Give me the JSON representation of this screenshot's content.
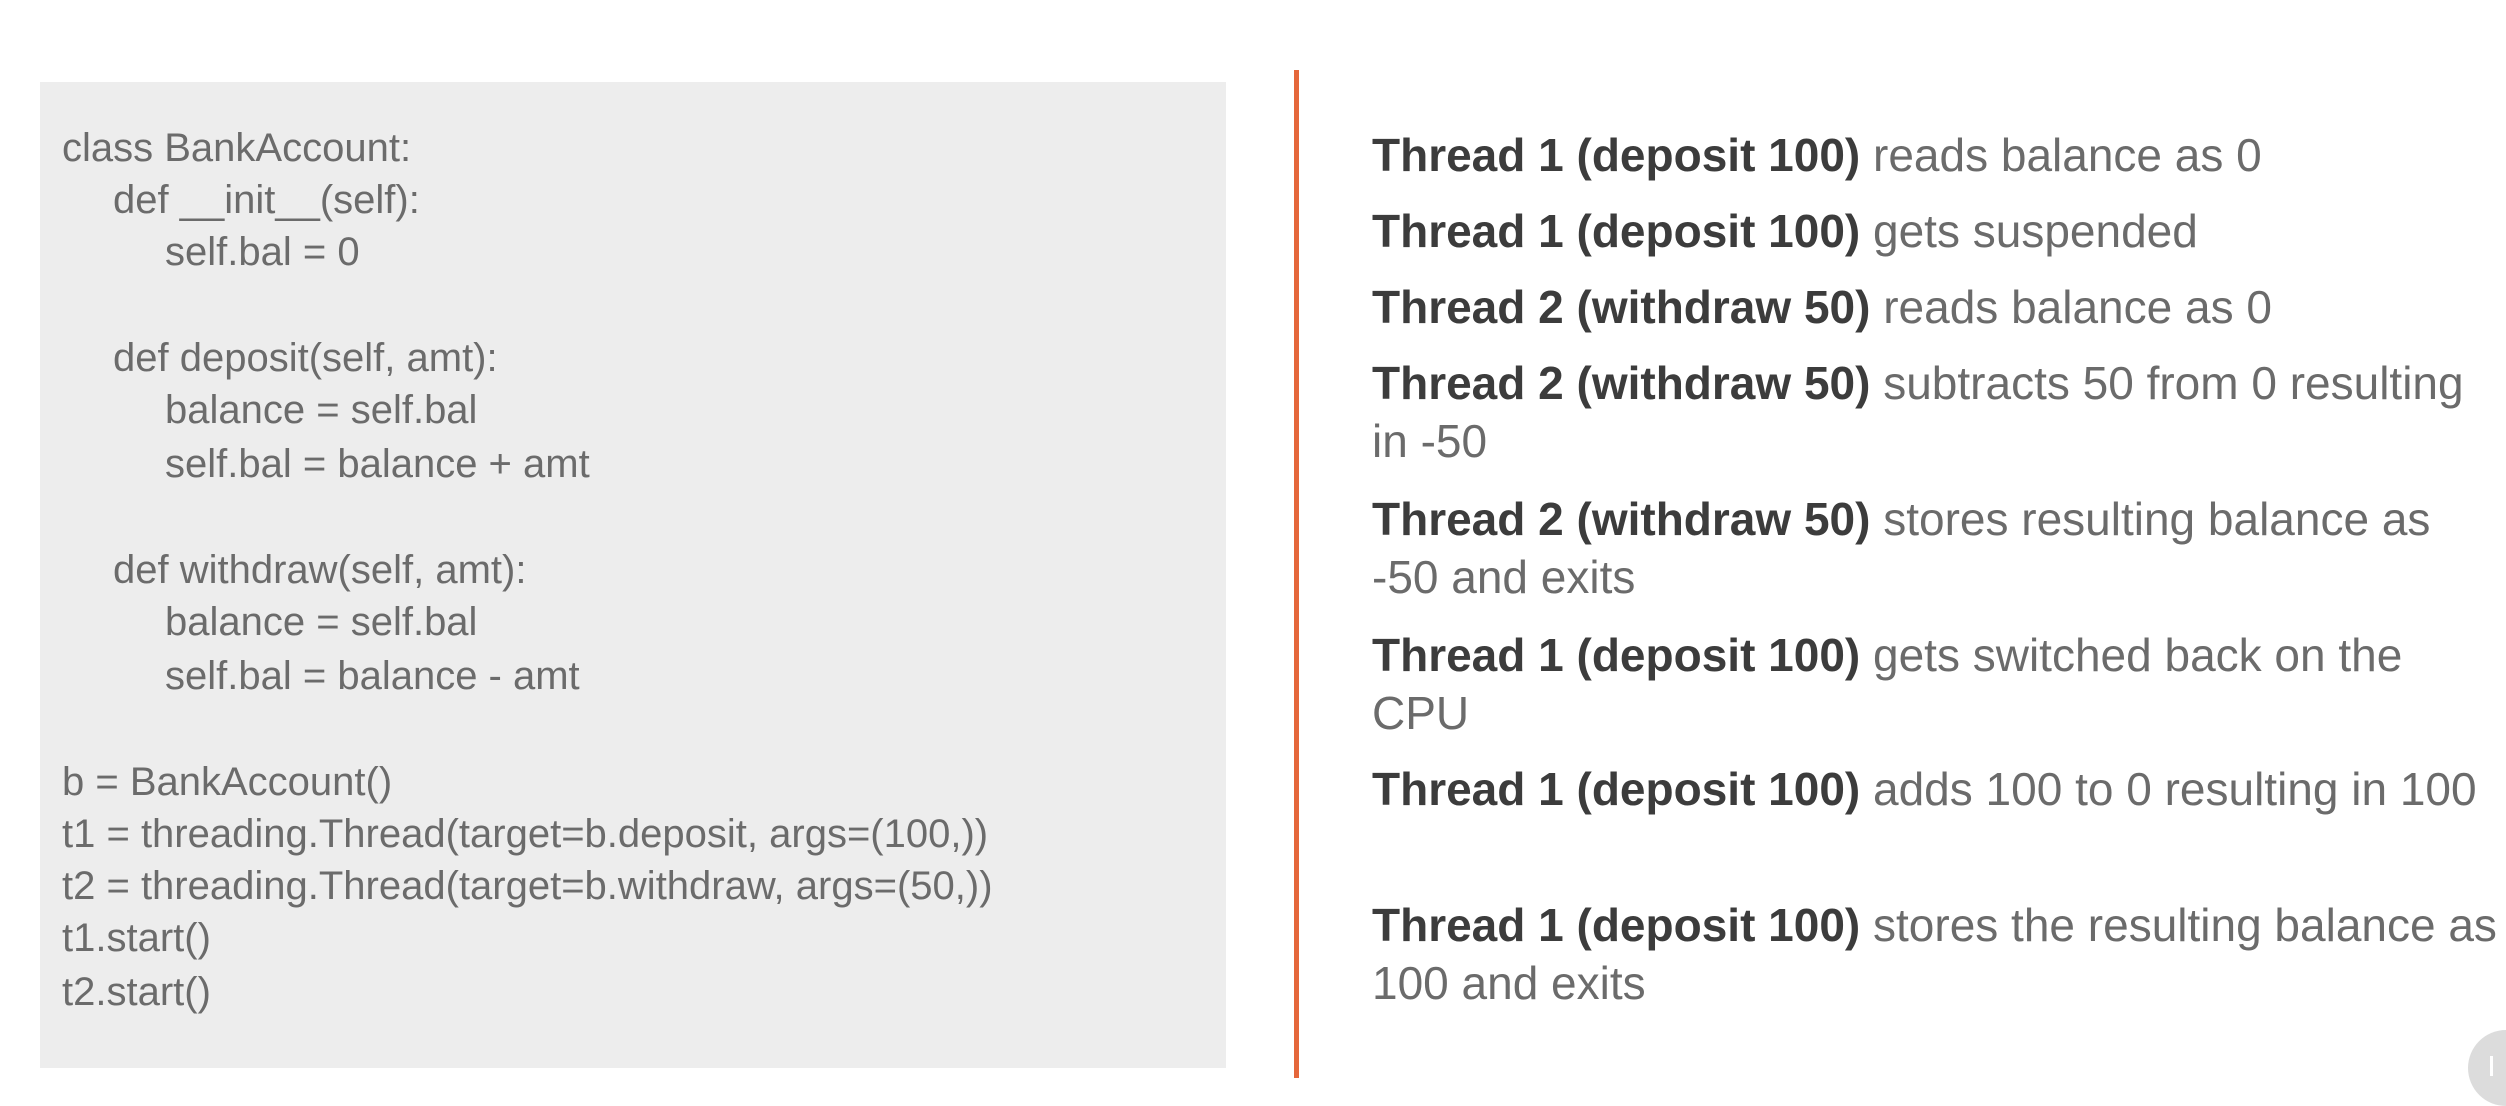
{
  "code": {
    "lines": [
      "class BankAccount:",
      "def __init__(self):",
      "self.bal = 0",
      "def deposit(self, amt):",
      "balance = self.bal",
      "self.bal = balance + amt",
      "def withdraw(self, amt):",
      "balance = self.bal",
      "self.bal = balance - amt",
      "b = BankAccount()",
      "t1 = threading.Thread(target=b.deposit, args=(100,))",
      "t2 = threading.Thread(target=b.withdraw, args=(50,))",
      "t1.start()",
      "t2.start()"
    ]
  },
  "steps": [
    {
      "actor": "Thread 1 (deposit 100)",
      "text": " reads balance as 0"
    },
    {
      "actor": "Thread 1 (deposit 100)",
      "text": " gets suspended"
    },
    {
      "actor": "Thread 2 (withdraw 50)",
      "text": " reads balance as 0"
    },
    {
      "actor": "Thread 2 (withdraw 50)",
      "text": " subtracts 50 from 0 resulting in -50"
    },
    {
      "actor": "Thread 2 (withdraw 50)",
      "text": " stores resulting balance as -50 and exits"
    },
    {
      "actor": "Thread 1 (deposit 100)",
      "text": " gets switched back on the CPU"
    },
    {
      "actor": "Thread 1 (deposit 100)",
      "text": "  adds 100 to 0 resulting in 100"
    },
    {
      "actor": "Thread 1 (deposit 100)",
      "text": " stores the resulting balance as 100 and exits"
    }
  ],
  "colors": {
    "divider": "#e5673b",
    "code_panel": "#ededed",
    "body_text": "#6b6b6b",
    "emphasis_text": "#3c3c3c"
  },
  "icons": {
    "corner": "pause-icon"
  }
}
